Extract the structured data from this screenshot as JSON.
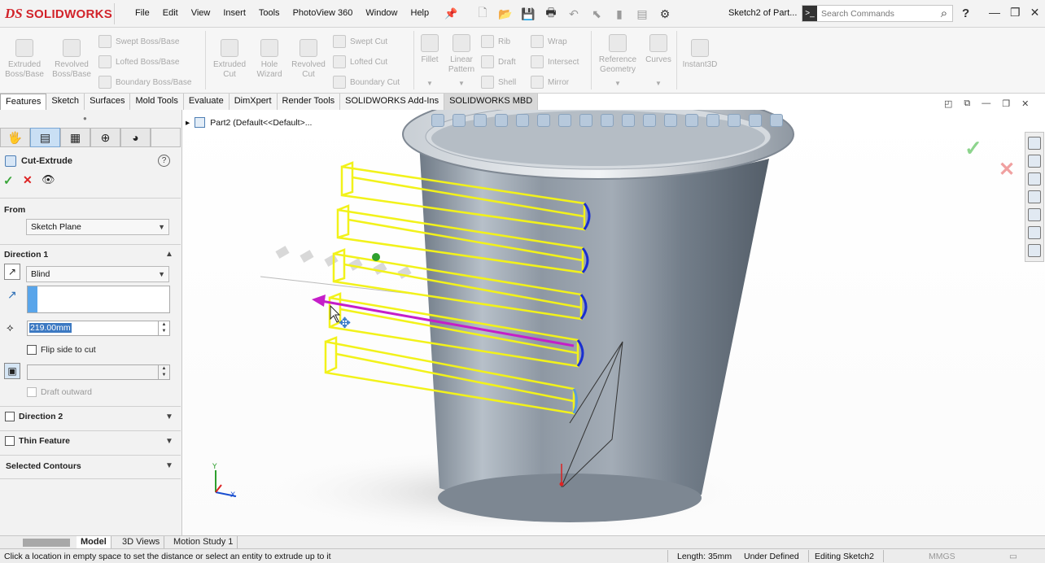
{
  "app": {
    "brand": "SOLIDWORKS",
    "brand_prefix": "DS",
    "menu": [
      "File",
      "Edit",
      "View",
      "Insert",
      "Tools",
      "PhotoView 360",
      "Window",
      "Help"
    ],
    "doc_title": "Sketch2 of Part...",
    "search_placeholder": "Search Commands",
    "help_glyph": "?",
    "accent": "#d2232a"
  },
  "command_manager": {
    "extruded_boss": "Extruded\nBoss/Base",
    "revolved_boss": "Revolved\nBoss/Base",
    "swept_boss": "Swept Boss/Base",
    "lofted_boss": "Lofted Boss/Base",
    "boundary_boss": "Boundary Boss/Base",
    "extruded_cut": "Extruded\nCut",
    "hole_wizard": "Hole\nWizard",
    "revolved_cut": "Revolved\nCut",
    "swept_cut": "Swept Cut",
    "lofted_cut": "Lofted Cut",
    "boundary_cut": "Boundary Cut",
    "fillet": "Fillet",
    "linear_pattern": "Linear\nPattern",
    "rib": "Rib",
    "draft": "Draft",
    "shell": "Shell",
    "wrap": "Wrap",
    "intersect": "Intersect",
    "mirror": "Mirror",
    "reference_geometry": "Reference\nGeometry",
    "curves": "Curves",
    "instant3d": "Instant3D"
  },
  "tabs": [
    "Features",
    "Sketch",
    "Surfaces",
    "Mold Tools",
    "Evaluate",
    "DimXpert",
    "Render Tools",
    "SOLIDWORKS Add-Ins",
    "SOLIDWORKS MBD"
  ],
  "property_manager": {
    "title": "Cut-Extrude",
    "from_label": "From",
    "from_value": "Sketch Plane",
    "direction1_label": "Direction 1",
    "end_condition": "Blind",
    "depth": "219.00mm",
    "flip_side": "Flip side to cut",
    "draft_outward": "Draft outward",
    "direction2_label": "Direction 2",
    "thin_feature_label": "Thin Feature",
    "selected_contours_label": "Selected Contours"
  },
  "tree": {
    "item": "Part2  (Default<<Default>..."
  },
  "bottom_tabs": [
    "Model",
    "3D Views",
    "Motion Study 1"
  ],
  "status": {
    "message": "Click a location in empty space to set the distance or select an entity to extrude up to it",
    "length": "Length: 35mm",
    "state": "Under Defined",
    "editing": "Editing Sketch2",
    "units": "MMGS"
  },
  "colors": {
    "preview_yellow": "#f2f21a",
    "arrow_magenta": "#c51ec9",
    "sketch_blue": "#1a2fd0"
  }
}
